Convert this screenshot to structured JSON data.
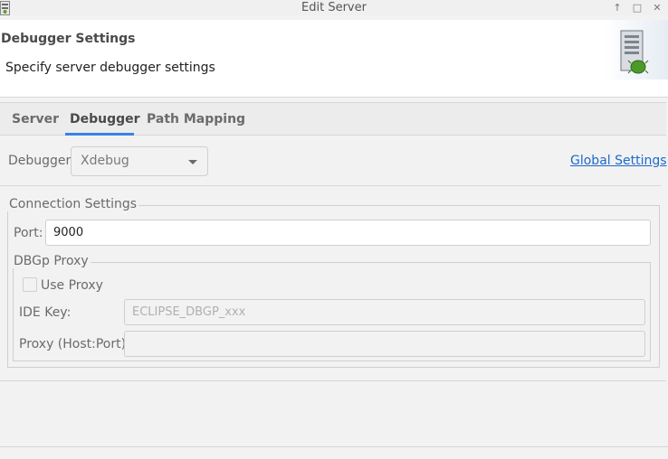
{
  "window": {
    "title": "Edit Server",
    "buttons": {
      "pin": "↑",
      "maximize": "□",
      "close": "✕"
    }
  },
  "header": {
    "title": "Debugger Settings",
    "description": "Specify server debugger settings"
  },
  "tabs": [
    {
      "label": "Server",
      "active": false
    },
    {
      "label": "Debugger",
      "active": true
    },
    {
      "label": "Path Mapping",
      "active": false
    }
  ],
  "debugger": {
    "label": "Debugger:",
    "selected": "Xdebug",
    "global_settings_link": "Global Settings"
  },
  "connection": {
    "group_title": "Connection Settings",
    "port_label": "Port:",
    "port_value": "9000"
  },
  "proxy": {
    "group_title": "DBGp Proxy",
    "use_proxy_label": "Use Proxy",
    "use_proxy_checked": false,
    "ide_key_label": "IDE Key:",
    "ide_key_placeholder": "ECLIPSE_DBGP_xxx",
    "host_port_label": "Proxy (Host:Port):",
    "host_port_value": ""
  },
  "colors": {
    "accent": "#3584e4",
    "link": "#1b6acb"
  }
}
